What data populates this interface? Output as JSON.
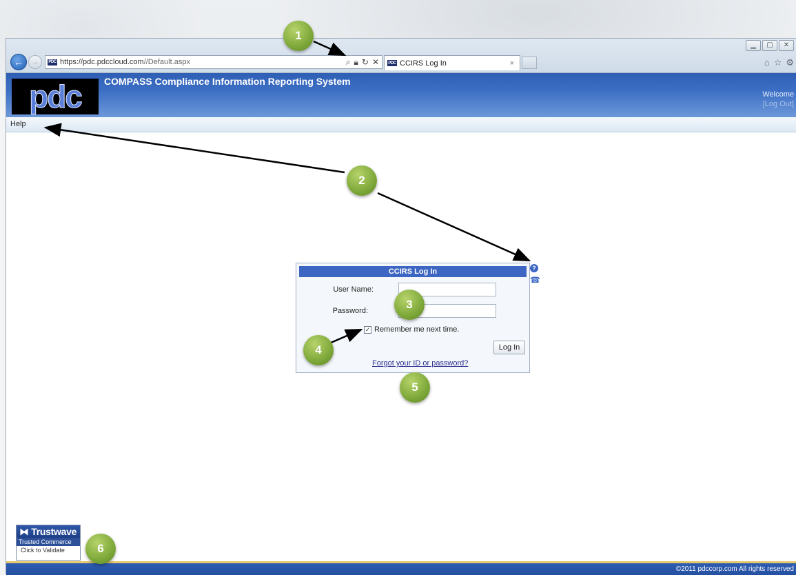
{
  "browser": {
    "url_host": "https://pdc.pdccloud.com",
    "url_path": "//Default.aspx",
    "tab_title": "CCIRS Log In",
    "tab_close": "×"
  },
  "header": {
    "logo": "pdc",
    "title": "COMPASS Compliance Information Reporting System",
    "welcome": "Welcome",
    "logout": "[Log Out]"
  },
  "menu": {
    "help": "Help"
  },
  "login": {
    "title": "CCIRS Log In",
    "username_label": "User Name:",
    "password_label": "Password:",
    "remember_label": "Remember me next time.",
    "remember_checked": "✓",
    "login_button": "Log In",
    "forgot_link": "Forgot your ID or password?"
  },
  "footer": {
    "seal_brand": "Trustwave",
    "seal_sub": "Trusted Commerce",
    "seal_action": "Click to Validate",
    "copyright": "©2011 pdccorp.com All rights reserved"
  },
  "callouts": [
    "1",
    "2",
    "3",
    "4",
    "5",
    "6"
  ]
}
